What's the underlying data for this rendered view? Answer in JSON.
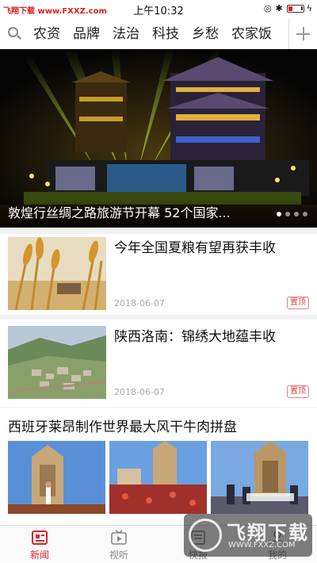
{
  "status_bar": {
    "carrier": "飞翔下载 www.FXXZ.com",
    "time": "上午10:32"
  },
  "categories": [
    "农资",
    "品牌",
    "法治",
    "科技",
    "乡愁",
    "农家饭"
  ],
  "hero": {
    "title": "敦煌行丝绸之路旅游节开幕 52个国家..."
  },
  "news": [
    {
      "title": "今年全国夏粮有望再获丰收",
      "date": "2018-06-07",
      "badge": "置顶"
    },
    {
      "title": "陕西洛南：锦绣大地蕴丰收",
      "date": "2018-06-07",
      "badge": "置顶"
    }
  ],
  "gallery": {
    "title": "西班牙莱昂制作世界最大风干牛肉拼盘"
  },
  "tabs": [
    {
      "label": "新闻",
      "icon": "news-icon"
    },
    {
      "label": "视听",
      "icon": "tv-icon"
    },
    {
      "label": "快报",
      "icon": "bulletin-icon"
    },
    {
      "label": "我的",
      "icon": "profile-icon"
    }
  ],
  "watermark": {
    "brand": "飞翔下载",
    "url": "WWW.FXXZ.COM"
  },
  "colors": {
    "accent": "#d9262c",
    "badge": "#e04040"
  }
}
